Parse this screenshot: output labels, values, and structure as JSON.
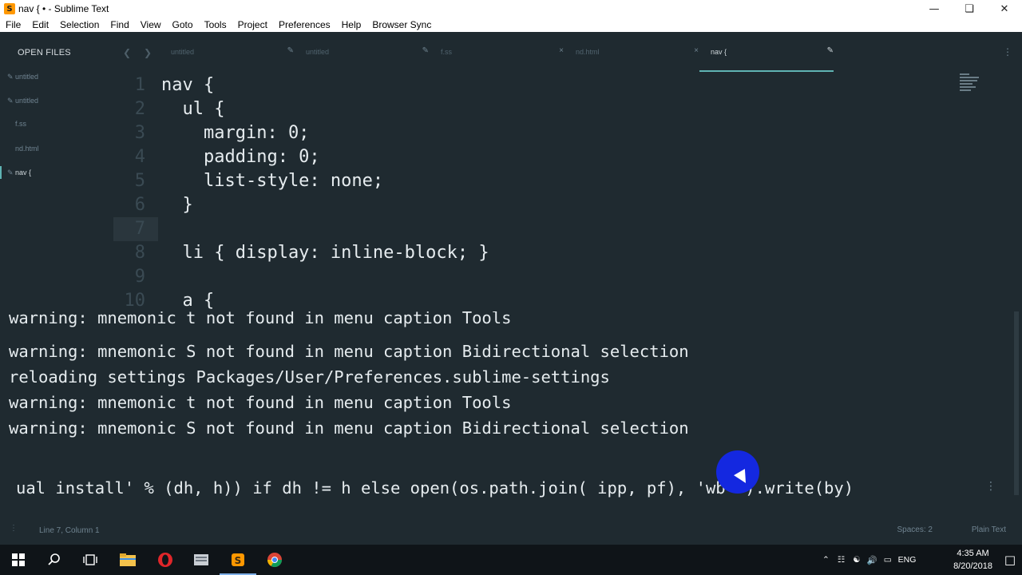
{
  "window": {
    "title": "nav { • - Sublime Text",
    "minimize_icon": "minimize-icon",
    "maximize_icon": "restore-icon",
    "close_icon": "close-icon"
  },
  "menu": [
    "File",
    "Edit",
    "Selection",
    "Find",
    "View",
    "Goto",
    "Tools",
    "Project",
    "Preferences",
    "Help",
    "Browser Sync"
  ],
  "sidebar": {
    "header": "OPEN FILES",
    "files": [
      {
        "label": "untitled",
        "dirty": true,
        "active": false
      },
      {
        "label": "untitled",
        "dirty": true,
        "active": false
      },
      {
        "label": "f.ss",
        "dirty": false,
        "active": false
      },
      {
        "label": "nd.html",
        "dirty": false,
        "active": false
      },
      {
        "label": "nav {",
        "dirty": true,
        "active": true
      }
    ]
  },
  "tabs": [
    {
      "label": "untitled",
      "close": "✎",
      "active": false
    },
    {
      "label": "untitled",
      "close": "✎",
      "active": false
    },
    {
      "label": "f.ss",
      "close": "×",
      "active": false
    },
    {
      "label": "nd.html",
      "close": "×",
      "active": false
    },
    {
      "label": "nav {",
      "close": "✎",
      "active": true
    }
  ],
  "editor": {
    "current_line": 7,
    "lines": [
      {
        "n": "1",
        "text": "nav {"
      },
      {
        "n": "2",
        "text": "  ul {"
      },
      {
        "n": "3",
        "text": "    margin: 0;"
      },
      {
        "n": "4",
        "text": "    padding: 0;"
      },
      {
        "n": "5",
        "text": "    list-style: none;"
      },
      {
        "n": "6",
        "text": "  }"
      },
      {
        "n": "7",
        "text": ""
      },
      {
        "n": "8",
        "text": "  li { display: inline-block; }"
      },
      {
        "n": "9",
        "text": ""
      },
      {
        "n": "10",
        "text": "  a {"
      }
    ]
  },
  "console": {
    "cut_line": "warning: mnemonic t not found in menu caption Tools",
    "lines": [
      "warning: mnemonic S not found in menu caption Bidirectional selection",
      "reloading settings Packages/User/Preferences.sublime-settings",
      "warning: mnemonic t not found in menu caption Tools",
      "warning: mnemonic S not found in menu caption Bidirectional selection"
    ]
  },
  "input": {
    "value": "ual install' % (dh, h)) if dh != h else open(os.path.join( ipp, pf), 'wb' ).write(by)"
  },
  "status": {
    "position": "Line 7, Column 1",
    "spaces": "Spaces: 2",
    "syntax": "Plain Text"
  },
  "taskbar": {
    "apps": [
      "start-icon",
      "search-icon",
      "task-view-icon",
      "file-explorer-icon",
      "opera-icon",
      "app-icon",
      "sublime-text-icon",
      "chrome-icon"
    ],
    "language": "ENG",
    "time": "4:35 AM",
    "date": "8/20/2018"
  },
  "colors": {
    "background": "#1f2a30",
    "accent": "#5fb3b3",
    "text": "#e6ecef",
    "line_number": "#3a4a53"
  }
}
